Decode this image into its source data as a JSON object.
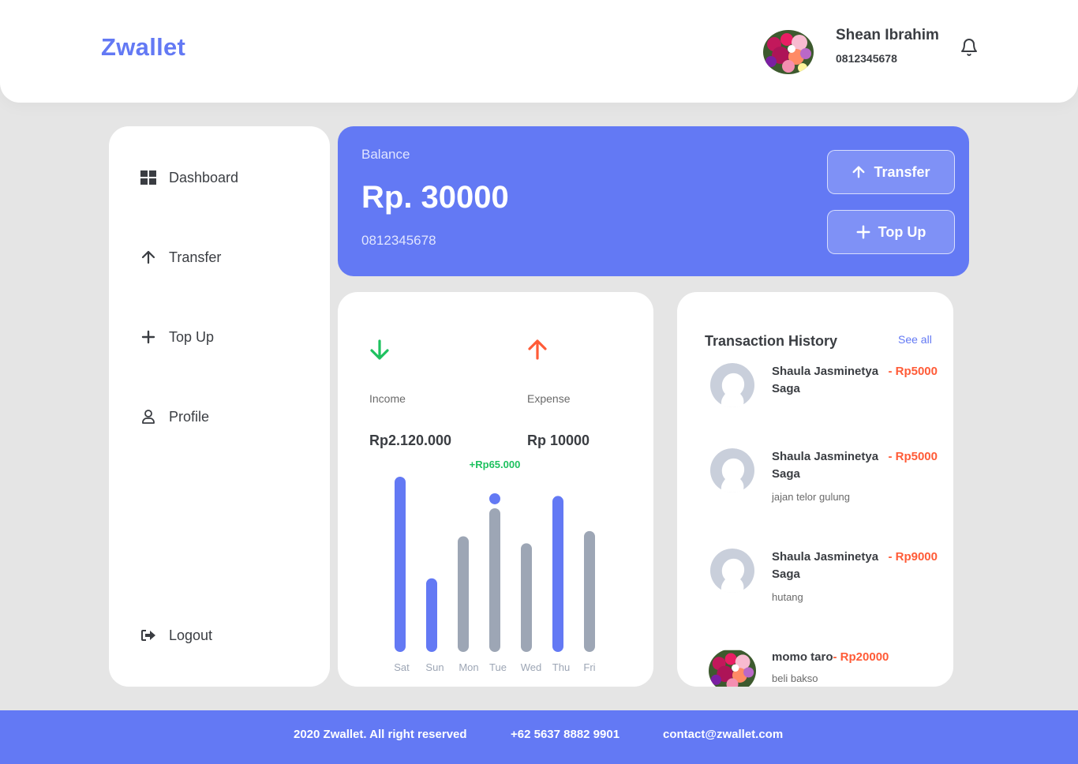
{
  "header": {
    "logo": "Zwallet",
    "user_name": "Shean Ibrahim",
    "user_phone": "0812345678",
    "avatar_icon": "flower-photo-avatar",
    "notification_icon": "bell-icon"
  },
  "sidebar": {
    "items": [
      {
        "label": "Dashboard",
        "icon": "grid-icon"
      },
      {
        "label": "Transfer",
        "icon": "arrow-up-icon"
      },
      {
        "label": "Top Up",
        "icon": "plus-icon"
      },
      {
        "label": "Profile",
        "icon": "user-icon"
      }
    ],
    "logout": {
      "label": "Logout",
      "icon": "logout-icon"
    }
  },
  "balance": {
    "label": "Balance",
    "amount": "Rp. 30000",
    "phone": "0812345678",
    "transfer_label": "Transfer",
    "topup_label": "Top Up"
  },
  "stats": {
    "income_label": "Income",
    "income_value": "Rp2.120.000",
    "expense_label": "Expense",
    "expense_value": "Rp 10000",
    "income_color": "#1ec15f",
    "expense_color": "#ff5b37"
  },
  "chart_data": {
    "type": "bar",
    "categories": [
      "Sat",
      "Sun",
      "Mon",
      "Tue",
      "Wed",
      "Thu",
      "Fri"
    ],
    "values": [
      100,
      42,
      66,
      82,
      62,
      89,
      69
    ],
    "bar_colors": [
      "#6379f4",
      "#6379f4",
      "#9da6b5",
      "#9da6b5",
      "#9da6b5",
      "#6379f4",
      "#9da6b5"
    ],
    "highlight_index": 3,
    "highlight_label": "+Rp65.000",
    "ylim": [
      0,
      100
    ]
  },
  "history": {
    "title": "Transaction History",
    "see_all": "See all",
    "items": [
      {
        "name": "Shaula Jasminetya Saga",
        "amount": "- Rp5000",
        "note": "",
        "avatar": "default-user-avatar"
      },
      {
        "name": "Shaula Jasminetya Saga",
        "amount": "- Rp5000",
        "note": "jajan telor gulung",
        "avatar": "default-user-avatar"
      },
      {
        "name": "Shaula Jasminetya Saga",
        "amount": "- Rp9000",
        "note": "hutang",
        "avatar": "default-user-avatar"
      },
      {
        "name": "momo taro",
        "amount": "- Rp20000",
        "note": "beli bakso",
        "avatar": "flower-photo-avatar"
      }
    ]
  },
  "footer": {
    "copyright": "2020 Zwallet. All right reserved",
    "phone": "+62 5637 8882 9901",
    "email": "contact@zwallet.com"
  }
}
